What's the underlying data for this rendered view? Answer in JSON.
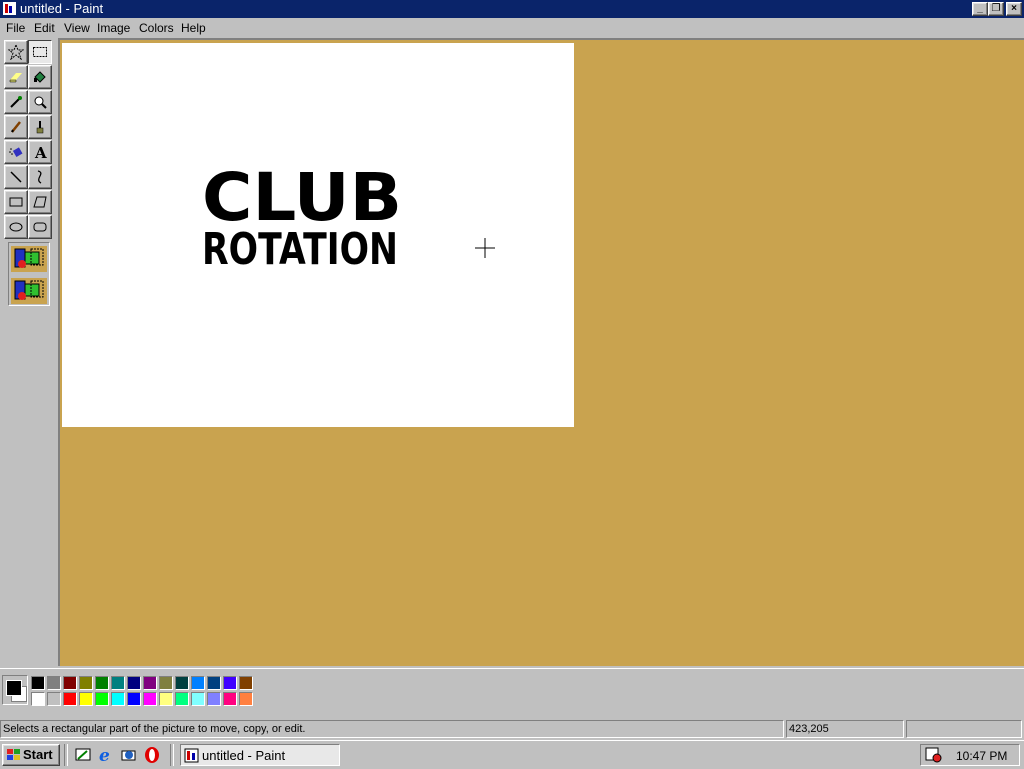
{
  "window": {
    "title": "untitled - Paint",
    "min_symbol": "_",
    "max_symbol": "❐",
    "close_symbol": "×"
  },
  "menu": [
    {
      "label": "File",
      "accel": "F"
    },
    {
      "label": "Edit",
      "accel": "E"
    },
    {
      "label": "View",
      "accel": "V"
    },
    {
      "label": "Image",
      "accel": "I"
    },
    {
      "label": "Colors",
      "accel": "C"
    },
    {
      "label": "Help",
      "accel": "H"
    }
  ],
  "tools": [
    "free-form-select",
    "select",
    "eraser",
    "fill-with-color",
    "pick-color",
    "magnifier",
    "pencil",
    "brush",
    "airbrush",
    "text",
    "line",
    "curve",
    "rectangle",
    "polygon",
    "ellipse",
    "rounded-rectangle"
  ],
  "canvas_art": {
    "line1": "CLUB",
    "line2": "ROTATION"
  },
  "palette": {
    "row1": [
      "#000000",
      "#808080",
      "#800000",
      "#808000",
      "#008000",
      "#008080",
      "#000080",
      "#800080",
      "#808040",
      "#004040",
      "#0080ff",
      "#004080",
      "#4000ff",
      "#804000"
    ],
    "row2": [
      "#ffffff",
      "#c0c0c0",
      "#ff0000",
      "#ffff00",
      "#00ff00",
      "#00ffff",
      "#0000ff",
      "#ff00ff",
      "#ffff80",
      "#00ff80",
      "#80ffff",
      "#8080ff",
      "#ff0080",
      "#ff8040"
    ],
    "foreground": "#000000",
    "background": "#ffffff"
  },
  "status": {
    "message": "Selects a rectangular part of the picture to move, copy, or edit.",
    "coords": "423,205",
    "size": ""
  },
  "taskbar": {
    "start": "Start",
    "task": "untitled - Paint",
    "time": "10:47 PM"
  },
  "colors": {
    "workspace": "#c9a34f",
    "titlebar": "#0a246a"
  }
}
